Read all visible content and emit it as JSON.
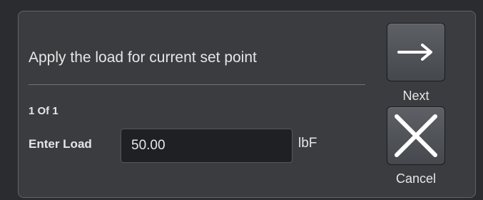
{
  "dialog": {
    "prompt": "Apply the load for current set point",
    "counter": "1 Of 1",
    "load_label": "Enter Load",
    "load_value": "50.00",
    "load_unit": "lbF"
  },
  "buttons": {
    "next_label": "Next",
    "next_icon": "arrow-right-icon",
    "cancel_label": "Cancel",
    "cancel_icon": "close-x-icon"
  },
  "colors": {
    "background": "#2a2c30",
    "panel": "#3a3c40",
    "text": "#e6e6e6",
    "input_background": "#1e2023"
  }
}
